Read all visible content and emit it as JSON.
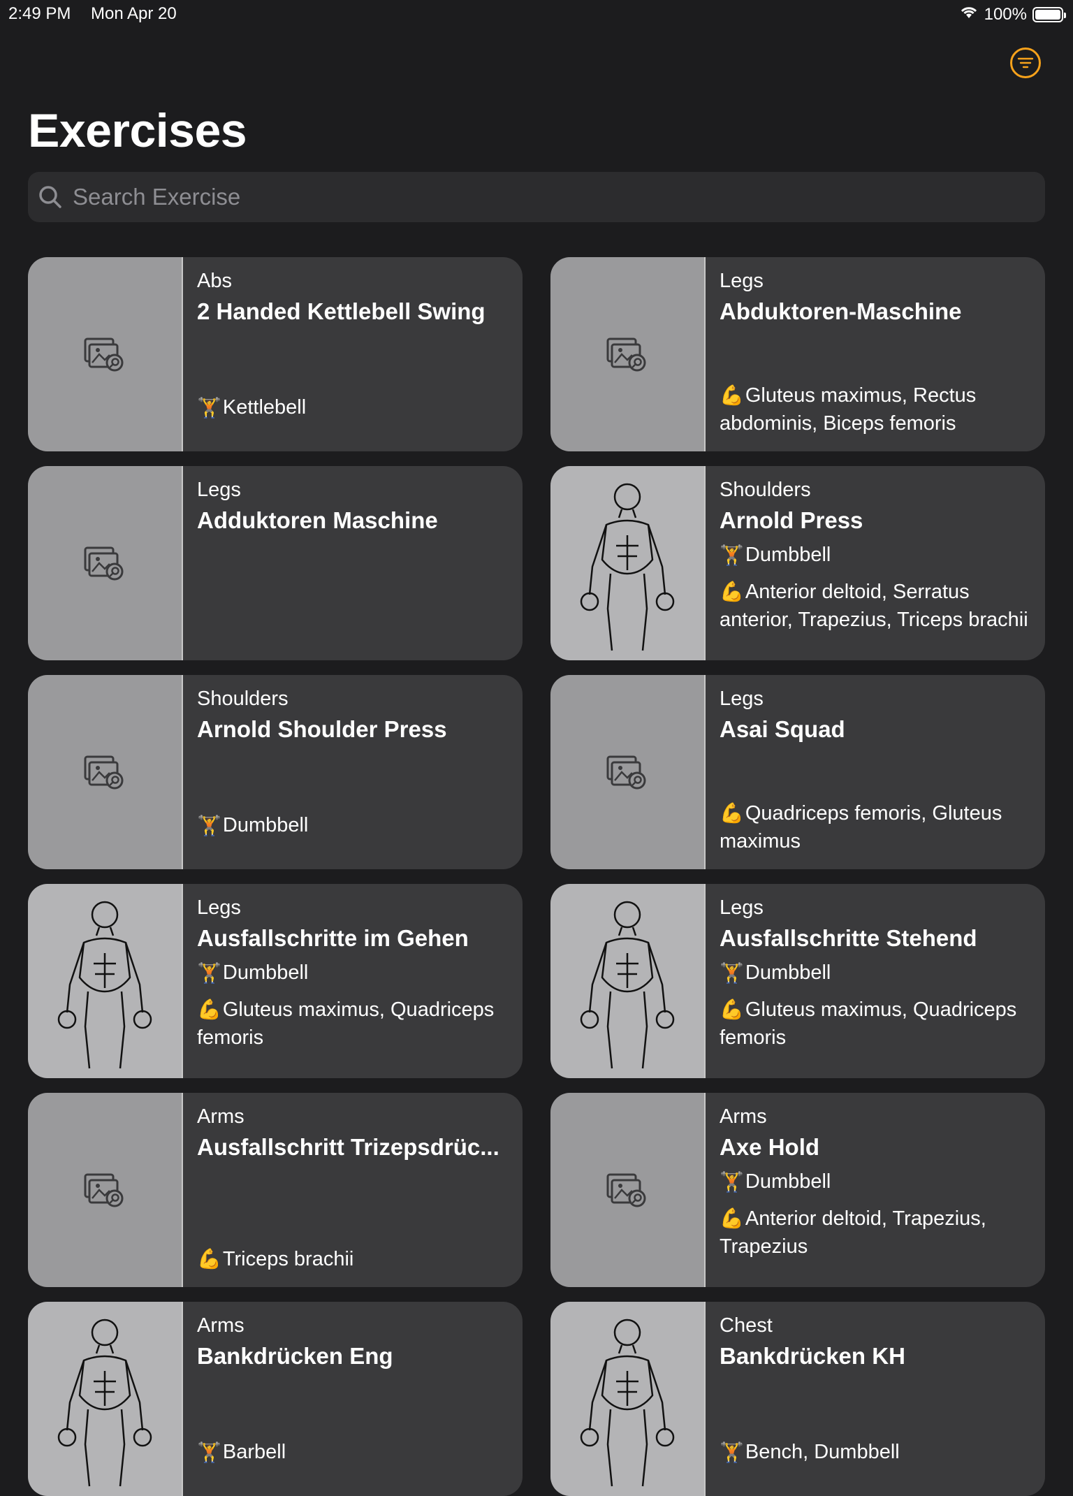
{
  "status_bar": {
    "time": "2:49 PM",
    "date": "Mon Apr 20",
    "battery": "100%"
  },
  "header": {
    "title": "Exercises",
    "filter_icon": "filter-lines-icon"
  },
  "search": {
    "placeholder": "Search Exercise"
  },
  "icons": {
    "equipment": "🏋",
    "muscle": "💪",
    "placeholder_image": "image-search-icon"
  },
  "colors": {
    "background": "#1c1c1e",
    "card": "#3a3a3c",
    "accent": "#f7a21b"
  },
  "exercises": [
    {
      "category": "Abs",
      "name": "2 Handed Kettlebell Swing",
      "equipment": "Kettlebell",
      "muscles": "",
      "image": "placeholder"
    },
    {
      "category": "Legs",
      "name": "Abduktoren-Maschine",
      "equipment": "",
      "muscles": "Gluteus maximus, Rectus abdominis, Biceps femoris",
      "image": "placeholder"
    },
    {
      "category": "Legs",
      "name": "Adduktoren Maschine",
      "equipment": "",
      "muscles": "",
      "image": "placeholder"
    },
    {
      "category": "Shoulders",
      "name": "Arnold Press",
      "equipment": "Dumbbell",
      "muscles": "Anterior deltoid, Serratus anterior, Trapezius, Triceps brachii",
      "image": "illustration"
    },
    {
      "category": "Shoulders",
      "name": "Arnold Shoulder Press",
      "equipment": "Dumbbell",
      "muscles": "",
      "image": "placeholder"
    },
    {
      "category": "Legs",
      "name": "Asai Squad",
      "equipment": "",
      "muscles": "Quadriceps femoris, Gluteus maximus",
      "image": "placeholder"
    },
    {
      "category": "Legs",
      "name": "Ausfallschritte im Gehen",
      "equipment": "Dumbbell",
      "muscles": "Gluteus maximus, Quadriceps femoris",
      "image": "illustration"
    },
    {
      "category": "Legs",
      "name": "Ausfallschritte Stehend",
      "equipment": "Dumbbell",
      "muscles": "Gluteus maximus, Quadriceps femoris",
      "image": "illustration"
    },
    {
      "category": "Arms",
      "name": "Ausfallschritt Trizepsdrüc...",
      "equipment": "",
      "muscles": "Triceps brachii",
      "image": "placeholder"
    },
    {
      "category": "Arms",
      "name": "Axe Hold",
      "equipment": "Dumbbell",
      "muscles": "Anterior deltoid, Trapezius, Trapezius",
      "image": "placeholder"
    },
    {
      "category": "Arms",
      "name": "Bankdrücken Eng",
      "equipment": "Barbell",
      "muscles": "",
      "image": "illustration"
    },
    {
      "category": "Chest",
      "name": "Bankdrücken KH",
      "equipment": "Bench, Dumbbell",
      "muscles": "",
      "image": "illustration"
    }
  ]
}
